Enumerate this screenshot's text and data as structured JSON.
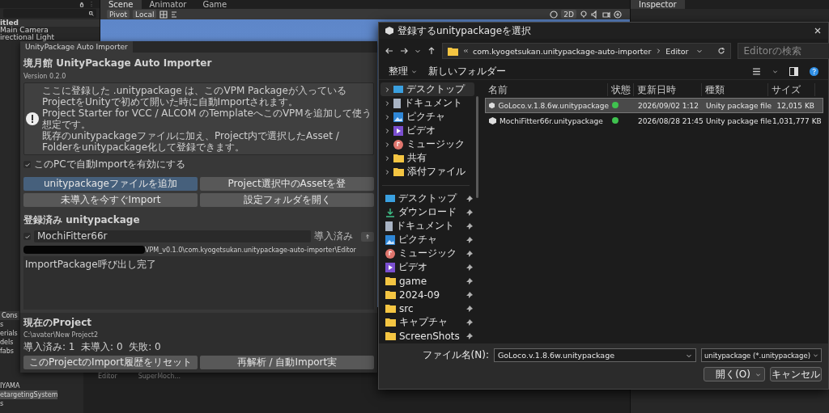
{
  "hierarchy": {
    "items": [
      {
        "label": "itled",
        "kind": "scene"
      },
      {
        "label": "Main Camera",
        "kind": "object"
      },
      {
        "label": "irectional Light",
        "kind": "object"
      }
    ]
  },
  "scene_tabs": [
    {
      "label": "Scene",
      "selected": true
    },
    {
      "label": "Animator",
      "selected": false
    },
    {
      "label": "Game",
      "selected": false
    }
  ],
  "scene_toolbar": {
    "pivot": "Pivot",
    "local": "Local",
    "mode_2d": "2D"
  },
  "inspector": {
    "tab": "Inspector"
  },
  "project_panel": {
    "tab": "Cons",
    "items": [
      {
        "label": "s",
        "selected": false
      },
      {
        "label": "erials",
        "selected": false
      },
      {
        "label": "dels",
        "selected": false
      },
      {
        "label": "fabs",
        "selected": false
      }
    ],
    "items_lower": [
      {
        "label": "IYAMA",
        "selected": false
      },
      {
        "label": "etargetingSystem",
        "selected": true
      },
      {
        "label": "s",
        "selected": false
      }
    ]
  },
  "console": {
    "rows": [
      {
        "type": "Editor",
        "message": "SuperMoch..."
      }
    ]
  },
  "importer": {
    "title": "UnityPackage Auto Importer",
    "heading": "境月館 UnityPackage Auto Importer",
    "version": "Version 0.2.0",
    "info_lines": [
      "ここに登録した .unitypackage は、このVPM Packageが入っているProjectをUnityで初めて開いた時に自動Importされます。",
      "Project Starter for VCC / ALCOM のTemplateへこのVPMを追加して使う想定です。",
      "既存のunitypackageファイルに加え、Project内で選択したAsset / Folderをunitypackage化して登録できます。"
    ],
    "auto_import": {
      "label": "このPCで自動Importを有効にする",
      "checked": true
    },
    "buttons": [
      {
        "label": "unitypackageファイルを追加",
        "primary": true
      },
      {
        "label": "Project選択中のAssetを登",
        "primary": false
      },
      {
        "label": "未導入を今すぐImport",
        "primary": false
      },
      {
        "label": "設定フォルダを開く",
        "primary": false
      }
    ],
    "registered_heading": "登録済み unitypackage",
    "packages": [
      {
        "name": "MochiFitter66r",
        "checked": true,
        "status": "導入済み"
      }
    ],
    "path": "VPM_v0.1.0\\com.kyogetsukan.unitypackage-auto-importer\\Editor",
    "log": "ImportPackage呼び出し完了",
    "project_heading": "現在のProject",
    "project_path": "C:\\avater\\New Project2",
    "counts": "導入済み: 1  未導入: 0  失敗: 0",
    "footer_buttons": [
      "このProjectのImport履歴をリセット",
      "再解析 / 自動Import実"
    ]
  },
  "file_dialog": {
    "title": "登録するunitypackageを選択",
    "breadcrumb": [
      "com.kyogetsukan.unitypackage-auto-importer",
      "Editor"
    ],
    "search_placeholder": "Editorの検索",
    "commands": [
      "整理",
      "新しいフォルダー"
    ],
    "tree": [
      {
        "label": "デスクトップ",
        "kind": "desktop",
        "selected": true
      },
      {
        "label": "ドキュメント",
        "kind": "document",
        "selected": false
      },
      {
        "label": "ピクチャ",
        "kind": "picture",
        "selected": false
      },
      {
        "label": "ビデオ",
        "kind": "video",
        "selected": false
      },
      {
        "label": "ミュージック",
        "kind": "music",
        "selected": false
      },
      {
        "label": "共有",
        "kind": "folder",
        "selected": false
      },
      {
        "label": "添付ファイル",
        "kind": "folder",
        "selected": false
      }
    ],
    "quick_access": [
      {
        "label": "デスクトップ",
        "kind": "desktop"
      },
      {
        "label": "ダウンロード",
        "kind": "download"
      },
      {
        "label": "ドキュメント",
        "kind": "document"
      },
      {
        "label": "ピクチャ",
        "kind": "picture"
      },
      {
        "label": "ミュージック",
        "kind": "music"
      },
      {
        "label": "ビデオ",
        "kind": "video"
      },
      {
        "label": "game",
        "kind": "folder"
      },
      {
        "label": "2024-09",
        "kind": "folder"
      },
      {
        "label": "src",
        "kind": "folder"
      },
      {
        "label": "キャプチャ",
        "kind": "folder"
      },
      {
        "label": "ScreenShots",
        "kind": "folder"
      }
    ],
    "columns": [
      "名前",
      "状態",
      "更新日時",
      "種類",
      "サイズ"
    ],
    "files": [
      {
        "name": "GoLoco.v.1.8.6w.unitypackage",
        "synced": true,
        "modified": "2026/09/02 1:12",
        "type": "Unity package file",
        "size": "12,015 KB",
        "selected": true
      },
      {
        "name": "MochiFitter66r.unitypackage",
        "synced": true,
        "modified": "2026/08/28 21:45",
        "type": "Unity package file",
        "size": "1,031,777 KB",
        "selected": false
      }
    ],
    "filename_label": "ファイル名(N):",
    "filename": "GoLoco.v.1.8.6w.unitypackage",
    "filter": "unitypackage (*.unitypackage)",
    "open": "開く(O)",
    "cancel": "キャンセル"
  }
}
